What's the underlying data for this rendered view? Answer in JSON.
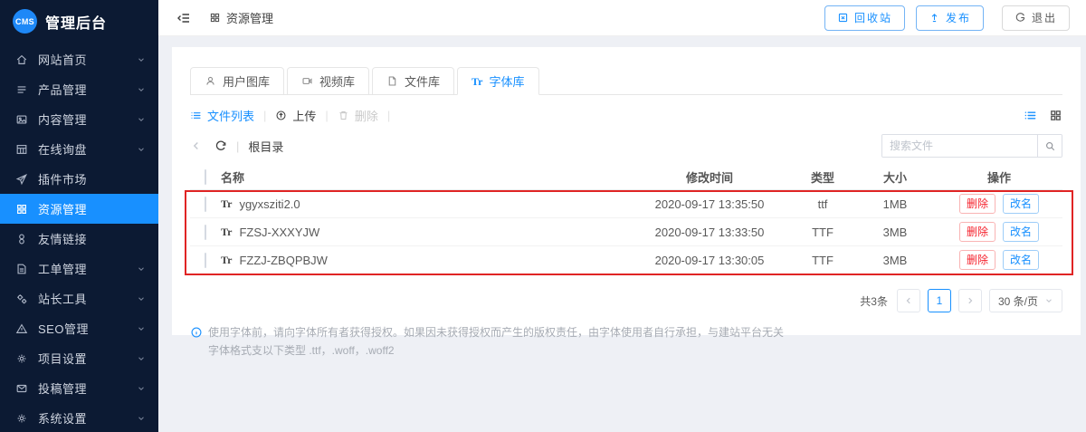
{
  "app": {
    "logo": "CMS",
    "title": "管理后台"
  },
  "sidebar": {
    "items": [
      {
        "label": "网站首页",
        "icon": "home-icon",
        "chevron": true,
        "active": false
      },
      {
        "label": "产品管理",
        "icon": "product-list-icon",
        "chevron": true,
        "active": false
      },
      {
        "label": "内容管理",
        "icon": "picture-icon",
        "chevron": true,
        "active": false
      },
      {
        "label": "在线询盘",
        "icon": "table-icon",
        "chevron": true,
        "active": false
      },
      {
        "label": "插件市场",
        "icon": "rocket-icon",
        "chevron": false,
        "active": false
      },
      {
        "label": "资源管理",
        "icon": "grid-icon",
        "chevron": false,
        "active": true
      },
      {
        "label": "友情链接",
        "icon": "link-icon",
        "chevron": false,
        "active": false
      },
      {
        "label": "工单管理",
        "icon": "document-icon",
        "chevron": true,
        "active": false
      },
      {
        "label": "站长工具",
        "icon": "gears-icon",
        "chevron": true,
        "active": false
      },
      {
        "label": "SEO管理",
        "icon": "warning-icon",
        "chevron": true,
        "active": false
      },
      {
        "label": "项目设置",
        "icon": "gear-icon",
        "chevron": true,
        "active": false
      },
      {
        "label": "投稿管理",
        "icon": "mail-icon",
        "chevron": true,
        "active": false
      },
      {
        "label": "系统设置",
        "icon": "gear-icon",
        "chevron": true,
        "active": false
      }
    ]
  },
  "topbar": {
    "breadcrumb": "资源管理",
    "breadcrumb_icon": "grid-icon",
    "collapse_icon": "menu-fold-icon",
    "buttons": [
      {
        "label": "回收站",
        "icon": "recycle-bin-icon"
      },
      {
        "label": "发布",
        "icon": "publish-up-icon"
      },
      {
        "label": "退出",
        "icon": "logout-icon"
      }
    ]
  },
  "tabs": [
    {
      "label": "用户图库",
      "icon": "user-icon",
      "active": false
    },
    {
      "label": "视频库",
      "icon": "video-icon",
      "active": false
    },
    {
      "label": "文件库",
      "icon": "file-icon",
      "active": false
    },
    {
      "label": "字体库",
      "icon": "font-tr-icon",
      "active": true
    }
  ],
  "toolbar": {
    "file_list_label": "文件列表",
    "upload_label": "上传",
    "delete_label": "删除",
    "separator": "|",
    "back_icon": "chevron-left-icon",
    "refresh_icon": "refresh-icon",
    "root_label": "根目录",
    "view_list_icon": "list-view-icon",
    "view_grid_icon": "grid-view-icon"
  },
  "search": {
    "placeholder": "搜索文件",
    "icon": "magnifier-icon"
  },
  "table": {
    "headers": {
      "name": "名称",
      "modified": "修改时间",
      "type": "类型",
      "size": "大小",
      "ops": "操作"
    },
    "rows": [
      {
        "name": "ygyxsziti2.0",
        "modified": "2020-09-17 13:35:50",
        "type": "ttf",
        "size": "1MB"
      },
      {
        "name": "FZSJ-XXXYJW",
        "modified": "2020-09-17 13:33:50",
        "type": "TTF",
        "size": "3MB"
      },
      {
        "name": "FZZJ-ZBQPBJW",
        "modified": "2020-09-17 13:30:05",
        "type": "TTF",
        "size": "3MB"
      }
    ],
    "row_icon": "Tr",
    "actions": {
      "delete": "删除",
      "rename": "改名"
    }
  },
  "pagination": {
    "total": "共3条",
    "current_page": "1",
    "page_size": "30 条/页"
  },
  "notice": {
    "line1": "使用字体前，请向字体所有者获得授权。如果因未获得授权而产生的版权责任，由字体使用者自行承担，与建站平台无关",
    "line2": "字体格式支以下类型 .ttf，.woff，.woff2"
  },
  "colors": {
    "accent": "#1890ff",
    "danger": "#f5222d",
    "annotation_red": "#e02424",
    "sidebar_bg": "#0c1a33"
  }
}
